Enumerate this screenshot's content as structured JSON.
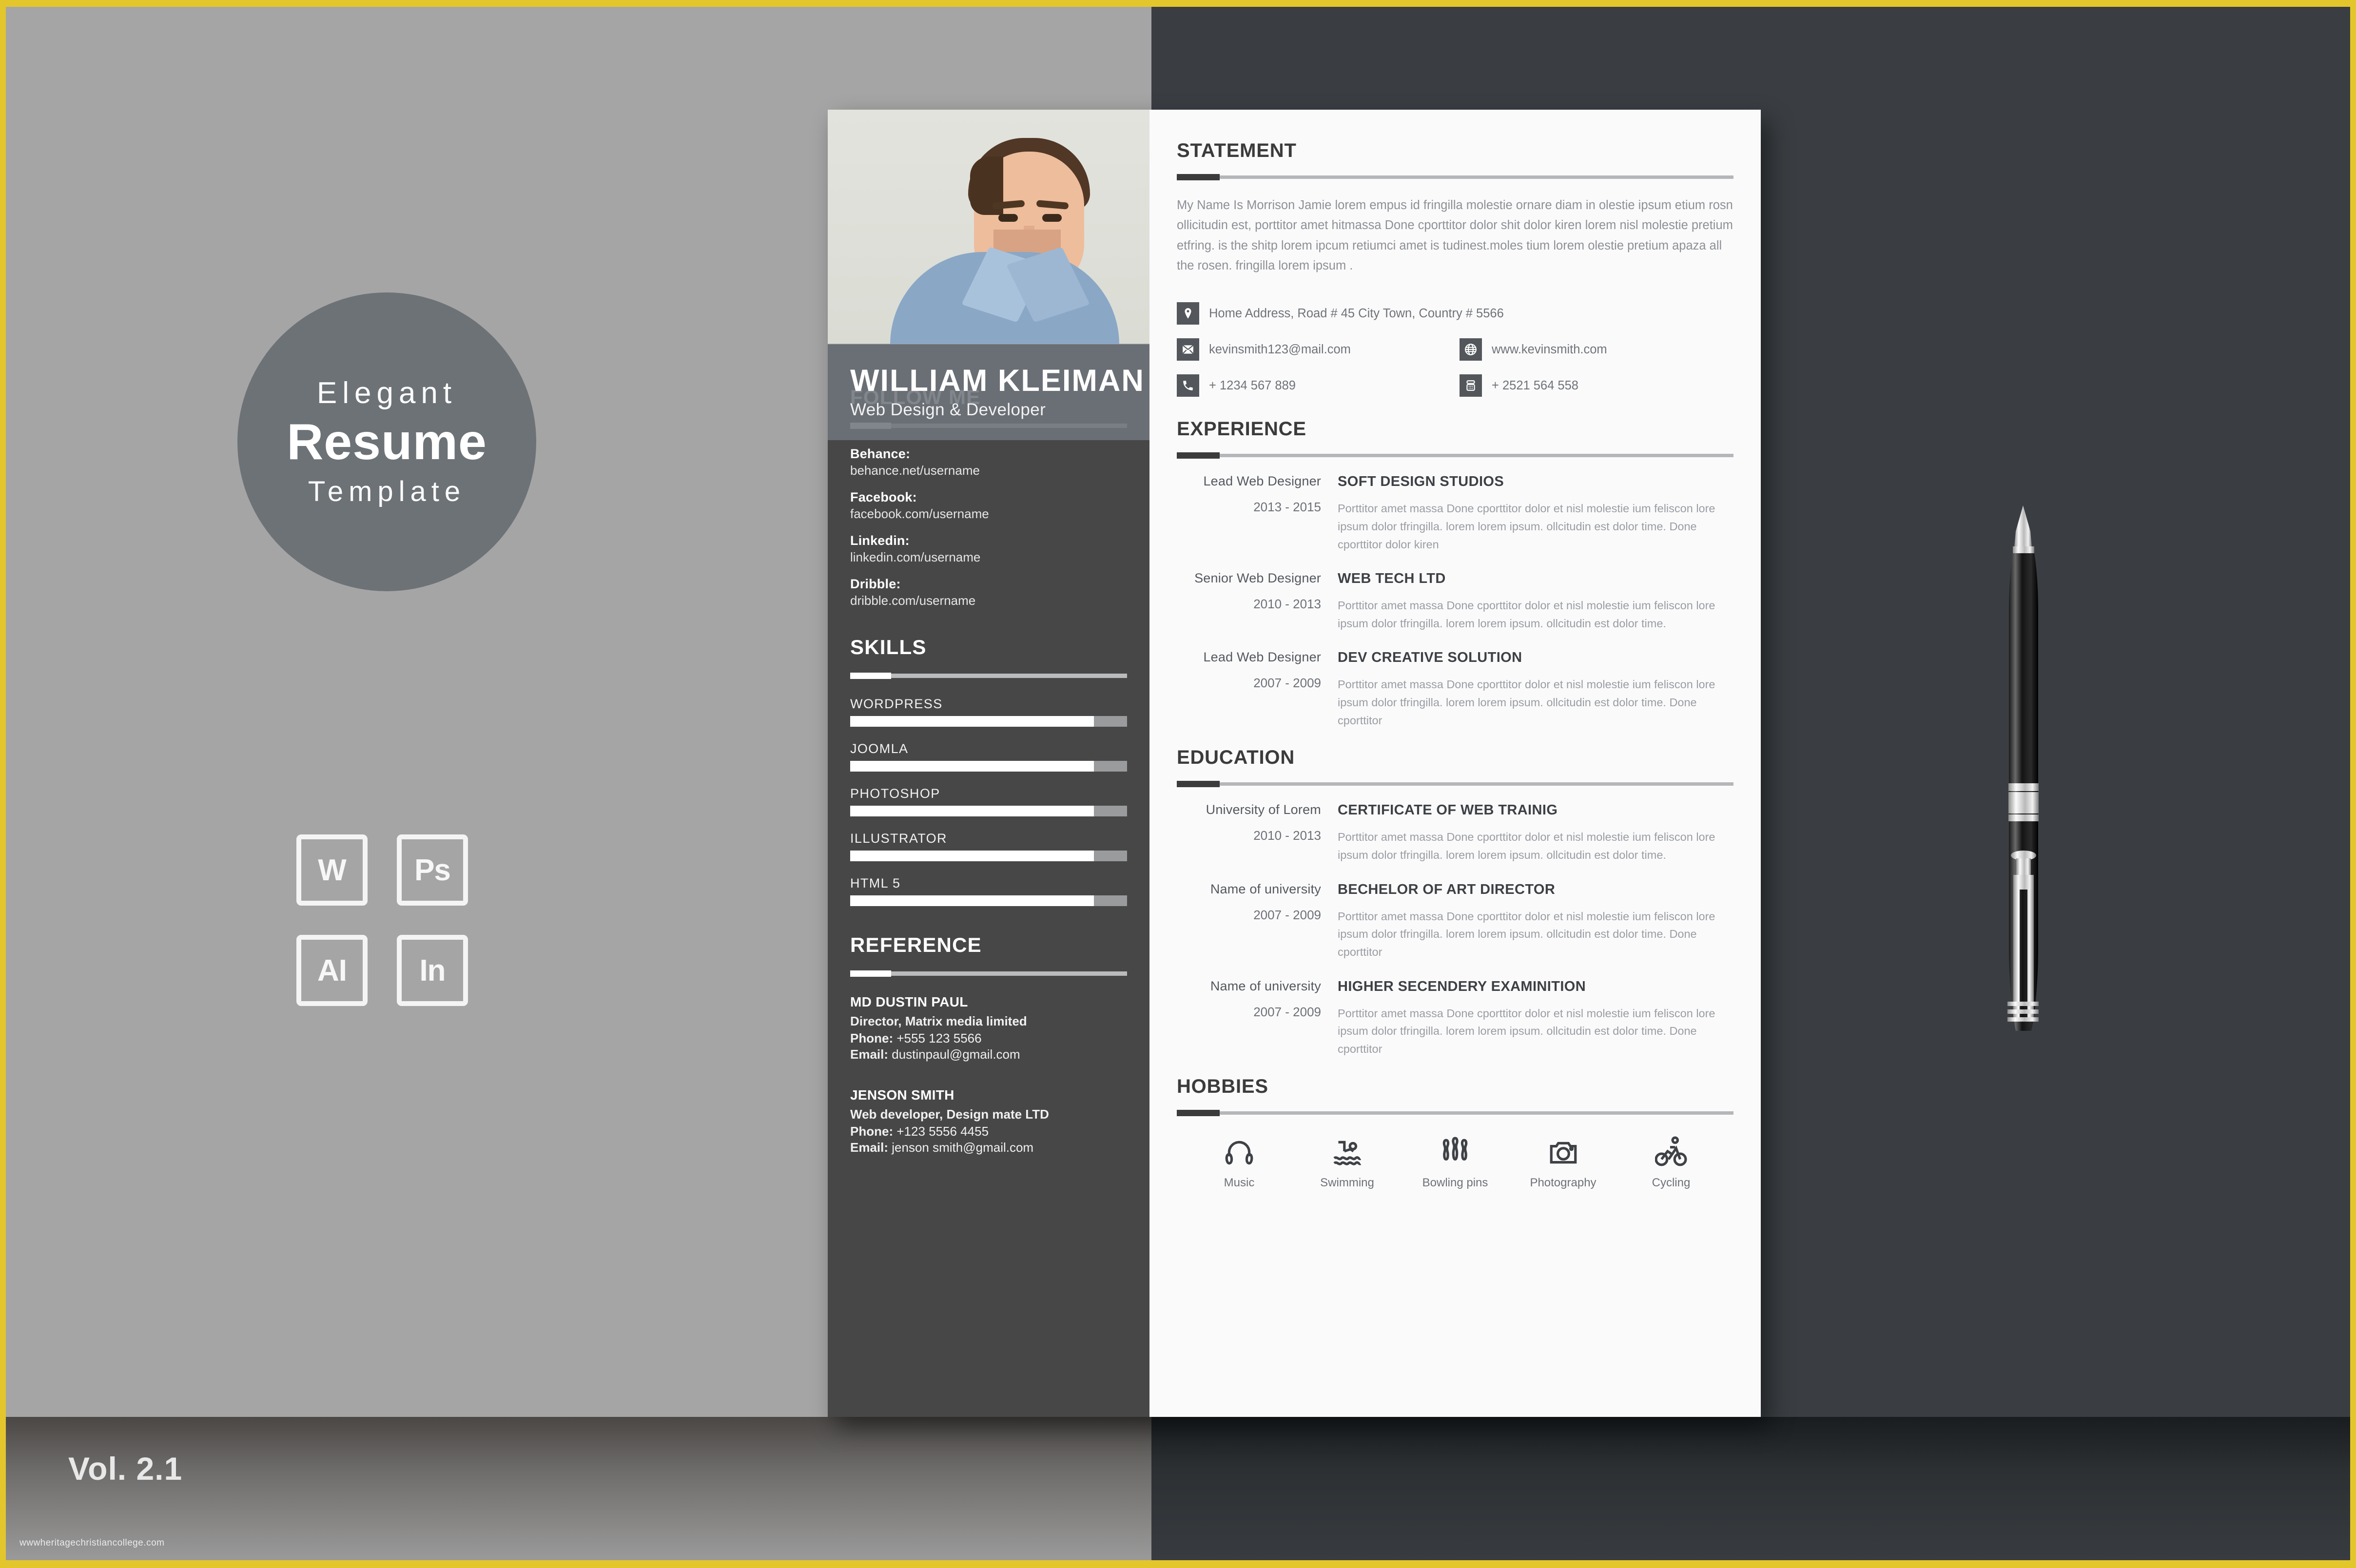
{
  "promo": {
    "line1": "Elegant",
    "line2": "Resume",
    "line3": "Template",
    "volume_label": "Vol. 2.1",
    "watermark": "wwwheritagechristiancollege.com",
    "format_badges": [
      "W",
      "Ps",
      "AI",
      "In"
    ]
  },
  "colors": {
    "backdrop_left": "#a5a5a5",
    "backdrop_right": "#3a3e42",
    "accent_border": "#e3c62c",
    "sidebar": "#474747",
    "paper": "#fafafb",
    "name_bar": "#70757c",
    "heading_dark": "#3b3b3b",
    "body_text": "#9a9da2"
  },
  "resume": {
    "name": "WILLIAM KLEIMAN",
    "role": "Web Design & Developer",
    "statement": {
      "heading": "STATEMENT",
      "text": "My Name Is Morrison Jamie lorem empus id fringilla molestie ornare diam in olestie ipsum etium rosn ollicitudin est, porttitor amet hitmassa Done cporttitor dolor shit dolor kiren lorem nisl molestie pretium etfring. is the shitp lorem ipcum retiumci amet is tudinest.moles tium lorem olestie pretium apaza all the rosen.  fringilla lorem ipsum ."
    },
    "contact": {
      "address": "Home Address, Road # 45 City Town, Country # 5566",
      "email": "kevinsmith123@mail.com",
      "website": "www.kevinsmith.com",
      "phone": "+ 1234 567 889",
      "landline": "+ 2521 564 558"
    },
    "follow_me": {
      "heading": "FOLLOW ME",
      "items": [
        {
          "label": "Behance:",
          "value": "behance.net/username"
        },
        {
          "label": "Facebook:",
          "value": "facebook.com/username"
        },
        {
          "label": "Linkedin:",
          "value": "linkedin.com/username"
        },
        {
          "label": "Dribble:",
          "value": "dribble.com/username"
        }
      ]
    },
    "skills": {
      "heading": "SKILLS",
      "items": [
        {
          "name": "WORDPRESS",
          "percent": 88
        },
        {
          "name": "JOOMLA",
          "percent": 88
        },
        {
          "name": "PHOTOSHOP",
          "percent": 88
        },
        {
          "name": "ILLUSTRATOR",
          "percent": 88
        },
        {
          "name": "HTML 5",
          "percent": 88
        }
      ]
    },
    "reference": {
      "heading": "REFERENCE",
      "items": [
        {
          "name": "MD DUSTIN PAUL",
          "title": "Director, Matrix media limited",
          "phone_label": "Phone:",
          "phone": "+555 123 5566",
          "email_label": "Email:",
          "email": "dustinpaul@gmail.com"
        },
        {
          "name": "JENSON SMITH",
          "title": "Web developer, Design mate LTD",
          "phone_label": "Phone:",
          "phone": "+123 5556 4455",
          "email_label": "Email:",
          "email": "jenson smith@gmail.com"
        }
      ]
    },
    "experience": {
      "heading": "EXPERIENCE",
      "entries": [
        {
          "role": "Lead  Web Designer",
          "years": "2013 - 2015",
          "org": "SOFT DESIGN STUDIOS",
          "description": "Porttitor amet massa Done cporttitor dolor et nisl molestie ium feliscon lore  ipsum dolor tfringilla. lorem lorem ipsum. ollcitudin est dolor time. Done cporttitor dolor kiren"
        },
        {
          "role": "Senior Web Designer",
          "years": "2010 - 2013",
          "org": "WEB TECH LTD",
          "description": "Porttitor amet massa Done cporttitor dolor et nisl molestie ium feliscon lore  ipsum dolor tfringilla. lorem lorem ipsum. ollcitudin est dolor time."
        },
        {
          "role": "Lead Web Designer",
          "years": "2007 - 2009",
          "org": "DEV CREATIVE SOLUTION",
          "description": "Porttitor amet massa Done cporttitor dolor et nisl molestie ium feliscon lore  ipsum dolor tfringilla. lorem lorem ipsum. ollcitudin est dolor time. Done cporttitor"
        }
      ]
    },
    "education": {
      "heading": "EDUCATION",
      "entries": [
        {
          "role": "University of Lorem",
          "years": "2010 - 2013",
          "org": "CERTIFICATE OF WEB TRAINIG",
          "description": "Porttitor amet massa Done cporttitor dolor et nisl molestie ium feliscon lore  ipsum dolor tfringilla. lorem lorem ipsum. ollcitudin est dolor time."
        },
        {
          "role": "Name of university",
          "years": "2007 - 2009",
          "org": "BECHELOR OF ART DIRECTOR",
          "description": "Porttitor amet massa Done cporttitor dolor et nisl molestie ium feliscon lore  ipsum dolor tfringilla. lorem lorem ipsum. ollcitudin est dolor time. Done cporttitor"
        },
        {
          "role": "Name of university",
          "years": "2007 - 2009",
          "org": "HIGHER SECENDERY EXAMINITION",
          "description": "Porttitor amet massa Done cporttitor dolor et nisl molestie ium feliscon lore  ipsum dolor tfringilla. lorem lorem ipsum. ollcitudin est dolor time. Done cporttitor"
        }
      ]
    },
    "hobbies": {
      "heading": "HOBBIES",
      "items": [
        {
          "label": "Music",
          "icon": "headphones-icon"
        },
        {
          "label": "Swimming",
          "icon": "swimmer-icon"
        },
        {
          "label": "Bowling pins",
          "icon": "bowling-pins-icon"
        },
        {
          "label": "Photography",
          "icon": "camera-icon"
        },
        {
          "label": "Cycling",
          "icon": "bicycle-icon"
        }
      ]
    }
  }
}
